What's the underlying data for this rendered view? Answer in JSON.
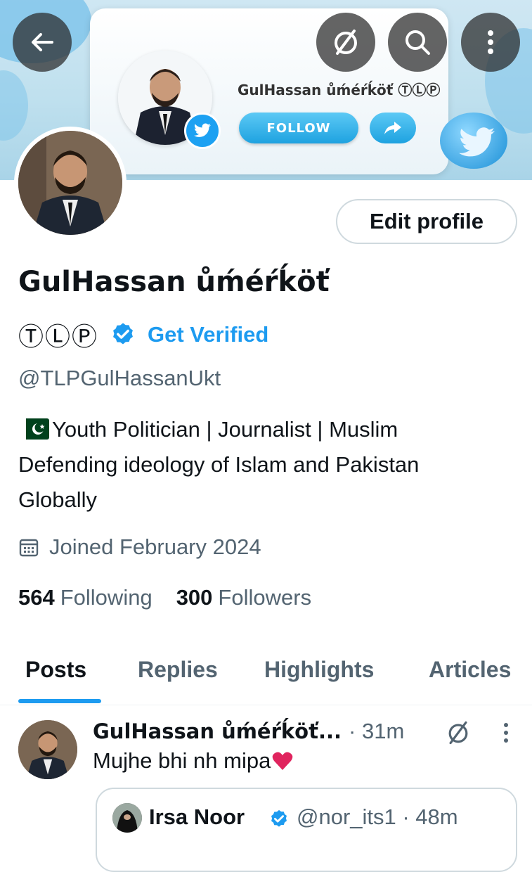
{
  "banner": {
    "name": "GulHassan ůḿéŕḱöť ⓉⓁⓅ",
    "follow_label": "FOLLOW"
  },
  "header": {
    "back_icon": "arrow-left-icon",
    "grok_icon": "slash-circle-icon",
    "search_icon": "search-icon",
    "more_icon": "more-vertical-icon"
  },
  "profile": {
    "edit_label": "Edit profile",
    "name": "GulHassan ůḿéŕḱöť",
    "tlp": "ⓉⓁⓅ",
    "get_verified": "Get Verified",
    "handle": "@TLPGulHassanUkt",
    "bio_line1": "Youth Politician | Journalist | Muslim",
    "bio_line2": "Defending ideology of Islam and Pakistan",
    "bio_line3": "Globally",
    "joined": "Joined February 2024",
    "following_count": "564",
    "following_label": "Following",
    "followers_count": "300",
    "followers_label": "Followers",
    "accent": "#1d9bf0"
  },
  "tabs": [
    {
      "label": "Posts",
      "active": true
    },
    {
      "label": "Replies",
      "active": false
    },
    {
      "label": "Highlights",
      "active": false
    },
    {
      "label": "Articles",
      "active": false
    }
  ],
  "post": {
    "author": "GulHassan ůḿéŕḱöť...",
    "time": "· 31m",
    "text": "Mujhe bhi nh mipa",
    "quote": {
      "name": "Irsa Noor",
      "handle": "@nor_its1 · 48m"
    }
  }
}
